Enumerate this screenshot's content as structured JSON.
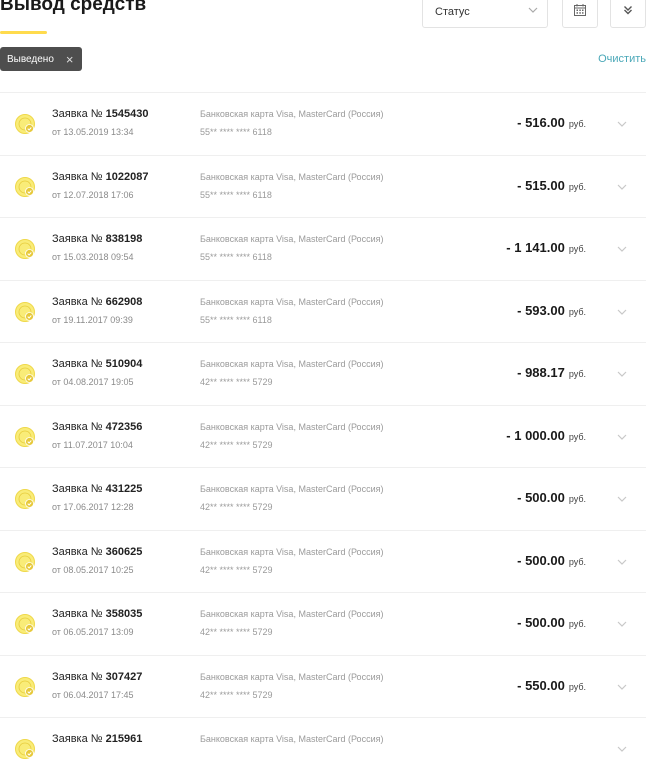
{
  "header": {
    "title": "Вывод средств",
    "status_label": "Статус",
    "clear_label": "Очистить",
    "filter_chip": "Выведено"
  },
  "colors": {
    "accent": "#ffdb4d",
    "chip_bg": "#4e4e4e",
    "link": "#4aa8b8",
    "status_icon": "#f7e75a"
  },
  "icons": {
    "status_chevron": "chevron-down-icon",
    "calendar": "calendar-icon",
    "expand": "double-chevron-down-icon",
    "chip_close": "close-icon",
    "row_status": "coin-check-icon",
    "row_expand": "chevron-down-icon"
  },
  "withdrawals": [
    {
      "label": "Заявка №",
      "number": "1545430",
      "date": "от 13.05.2019 13:34",
      "method": "Банковская карта Visa, MasterCard (Россия)",
      "card": "55** **** **** 6118",
      "amount": "- 516.00",
      "currency": "руб."
    },
    {
      "label": "Заявка №",
      "number": "1022087",
      "date": "от 12.07.2018 17:06",
      "method": "Банковская карта Visa, MasterCard (Россия)",
      "card": "55** **** **** 6118",
      "amount": "- 515.00",
      "currency": "руб."
    },
    {
      "label": "Заявка №",
      "number": "838198",
      "date": "от 15.03.2018 09:54",
      "method": "Банковская карта Visa, MasterCard (Россия)",
      "card": "55** **** **** 6118",
      "amount": "- 1 141.00",
      "currency": "руб."
    },
    {
      "label": "Заявка №",
      "number": "662908",
      "date": "от 19.11.2017 09:39",
      "method": "Банковская карта Visa, MasterCard (Россия)",
      "card": "55** **** **** 6118",
      "amount": "- 593.00",
      "currency": "руб."
    },
    {
      "label": "Заявка №",
      "number": "510904",
      "date": "от 04.08.2017 19:05",
      "method": "Банковская карта Visa, MasterCard (Россия)",
      "card": "42** **** **** 5729",
      "amount": "- 988.17",
      "currency": "руб."
    },
    {
      "label": "Заявка №",
      "number": "472356",
      "date": "от 11.07.2017 10:04",
      "method": "Банковская карта Visa, MasterCard (Россия)",
      "card": "42** **** **** 5729",
      "amount": "- 1 000.00",
      "currency": "руб."
    },
    {
      "label": "Заявка №",
      "number": "431225",
      "date": "от 17.06.2017 12:28",
      "method": "Банковская карта Visa, MasterCard (Россия)",
      "card": "42** **** **** 5729",
      "amount": "- 500.00",
      "currency": "руб."
    },
    {
      "label": "Заявка №",
      "number": "360625",
      "date": "от 08.05.2017 10:25",
      "method": "Банковская карта Visa, MasterCard (Россия)",
      "card": "42** **** **** 5729",
      "amount": "- 500.00",
      "currency": "руб."
    },
    {
      "label": "Заявка №",
      "number": "358035",
      "date": "от 06.05.2017 13:09",
      "method": "Банковская карта Visa, MasterCard (Россия)",
      "card": "42** **** **** 5729",
      "amount": "- 500.00",
      "currency": "руб."
    },
    {
      "label": "Заявка №",
      "number": "307427",
      "date": "от 06.04.2017 17:45",
      "method": "Банковская карта Visa, MasterCard (Россия)",
      "card": "42** **** **** 5729",
      "amount": "- 550.00",
      "currency": "руб."
    },
    {
      "label": "Заявка №",
      "number": "215961",
      "date": "",
      "method": "Банковская карта Visa, MasterCard (Россия)",
      "card": "",
      "amount": "",
      "currency": ""
    }
  ]
}
